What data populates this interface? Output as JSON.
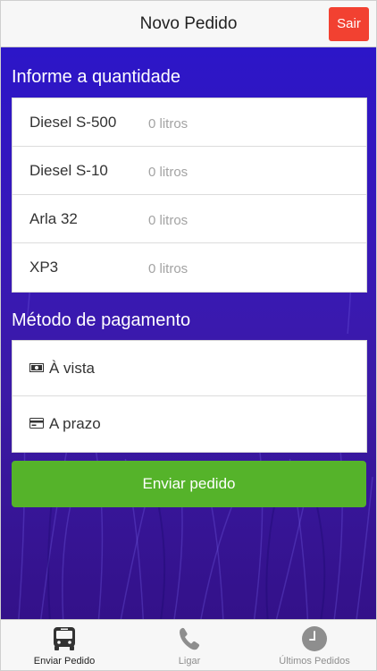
{
  "header": {
    "title": "Novo Pedido",
    "logout_label": "Sair"
  },
  "quantity": {
    "title": "Informe a quantidade",
    "products": [
      {
        "name": "Diesel S-500",
        "placeholder": "0 litros"
      },
      {
        "name": "Diesel S-10",
        "placeholder": "0 litros"
      },
      {
        "name": "Arla 32",
        "placeholder": "0 litros"
      },
      {
        "name": "XP3",
        "placeholder": "0 litros"
      }
    ]
  },
  "payment": {
    "title": "Método de pagamento",
    "options": [
      {
        "label": "À vista",
        "icon": "cash-icon"
      },
      {
        "label": "A prazo",
        "icon": "credit-card-icon"
      }
    ]
  },
  "submit_label": "Enviar pedido",
  "tabs": [
    {
      "label": "Enviar Pedido",
      "icon": "bus-icon",
      "active": true
    },
    {
      "label": "Ligar",
      "icon": "phone-icon",
      "active": false
    },
    {
      "label": "Últimos Pedidos",
      "icon": "clock-icon",
      "active": false
    }
  ],
  "colors": {
    "accent_green": "#55b32a",
    "logout_red": "#f24131",
    "background_purple": "#3818b7"
  }
}
